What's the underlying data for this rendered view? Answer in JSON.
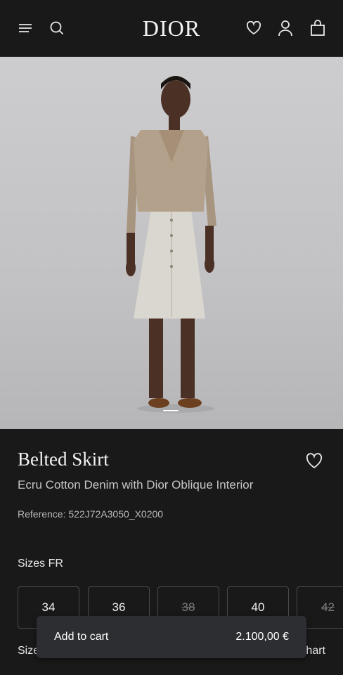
{
  "header": {
    "logo": "DIOR",
    "icons": [
      "menu-icon",
      "search-icon",
      "wishlist-icon",
      "account-icon",
      "bag-icon"
    ]
  },
  "hero": {
    "image_alt": "Model wearing belted ecru skirt and beige cardigan",
    "active_slide": 1
  },
  "product": {
    "title": "Belted Skirt",
    "subtitle": "Ecru Cotton Denim with Dior Oblique Interior",
    "reference": "Reference: 522J72A3050_X0200"
  },
  "sizes": {
    "label": "Sizes FR",
    "items": [
      {
        "label": "34",
        "available": true
      },
      {
        "label": "36",
        "available": true
      },
      {
        "label": "38",
        "available": false
      },
      {
        "label": "40",
        "available": true
      },
      {
        "label": "42",
        "available": false
      }
    ]
  },
  "footer_links": {
    "left": "Size",
    "right": "hart"
  },
  "cart": {
    "label": "Add to cart",
    "price": "2.100,00 €"
  }
}
